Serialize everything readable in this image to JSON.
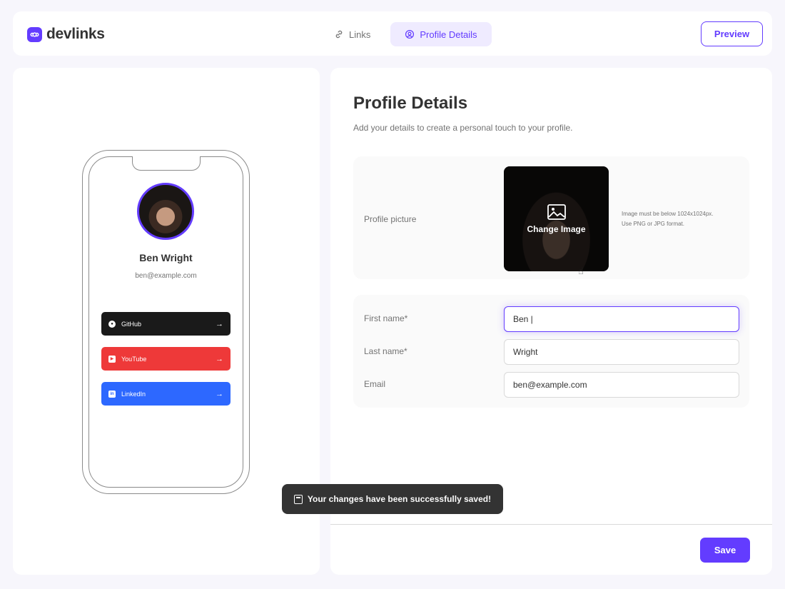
{
  "brand": {
    "name": "devlinks",
    "accent": "#633cff"
  },
  "nav": {
    "tabs": [
      {
        "label": "Links",
        "icon": "link-icon",
        "active": false
      },
      {
        "label": "Profile Details",
        "icon": "user-circle-icon",
        "active": true
      }
    ],
    "preview_label": "Preview"
  },
  "phone_preview": {
    "name": "Ben Wright",
    "email": "ben@example.com",
    "links": [
      {
        "label": "GitHub",
        "color": "#1a1a1a",
        "icon": "github-icon"
      },
      {
        "label": "YouTube",
        "color": "#ee3939",
        "icon": "youtube-icon"
      },
      {
        "label": "LinkedIn",
        "color": "#2d68ff",
        "icon": "linkedin-icon"
      }
    ]
  },
  "profile": {
    "title": "Profile Details",
    "subtitle": "Add your details to create a personal touch to your profile.",
    "picture_label": "Profile picture",
    "change_image_label": "Change Image",
    "picture_hint_line1": "Image must be below 1024x1024px.",
    "picture_hint_line2": "Use PNG or JPG format.",
    "fields": {
      "first_name": {
        "label": "First name*",
        "value": "Ben |"
      },
      "last_name": {
        "label": "Last name*",
        "value": "Wright"
      },
      "email": {
        "label": "Email",
        "value": "ben@example.com"
      }
    },
    "save_label": "Save"
  },
  "toast": {
    "message": "Your changes have been successfully saved!",
    "icon": "save-disk-icon"
  }
}
